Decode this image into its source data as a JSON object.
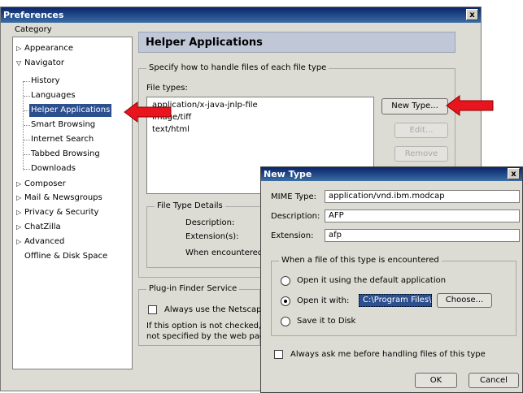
{
  "window": {
    "title": "Preferences",
    "close_label": "x"
  },
  "category": {
    "label": "Category",
    "items": [
      {
        "label": "Appearance"
      },
      {
        "label": "Navigator"
      },
      {
        "label": "History"
      },
      {
        "label": "Languages"
      },
      {
        "label": "Helper Applications"
      },
      {
        "label": "Smart Browsing"
      },
      {
        "label": "Internet Search"
      },
      {
        "label": "Tabbed Browsing"
      },
      {
        "label": "Downloads"
      },
      {
        "label": "Composer"
      },
      {
        "label": "Mail & Newsgroups"
      },
      {
        "label": "Privacy & Security"
      },
      {
        "label": "ChatZilla"
      },
      {
        "label": "Advanced"
      },
      {
        "label": "Offline & Disk Space"
      }
    ]
  },
  "panel": {
    "title": "Helper Applications",
    "group1_title": "Specify how to handle files of each file type",
    "file_types_label": "File types:",
    "file_types": [
      "application/x-java-jnlp-file",
      "image/tiff",
      "text/html"
    ],
    "new_type_button": "New Type...",
    "edit_button": "Edit...",
    "remove_button": "Remove",
    "details_title": "File Type Details",
    "description_label": "Description:",
    "extensions_label": "Extension(s):",
    "when_label": "When encountered",
    "plugin_title": "Plug-in Finder Service",
    "plugin_checkbox_label": "Always use the Netscape",
    "plugin_note_line1": "If this option is not checked, t",
    "plugin_note_line2": "not specified by the web pag"
  },
  "dialog": {
    "title": "New Type",
    "close_label": "x",
    "mime_label": "MIME Type:",
    "mime_value": "application/vnd.ibm.modcap",
    "description_label": "Description:",
    "description_value": "AFP",
    "extension_label": "Extension:",
    "extension_value": "afp",
    "group_title": "When a file of this type is encountered",
    "radio_default": "Open it using the default application",
    "radio_open_with": "Open it with:",
    "open_with_path": "C:\\Program Files\\IBM",
    "choose_button": "Choose...",
    "radio_save": "Save it to Disk",
    "ask_checkbox": "Always ask me before handling files of this type",
    "ok_button": "OK",
    "cancel_button": "Cancel"
  },
  "colors": {
    "arrow": "#e8141e",
    "selection": "#2b4f8f",
    "titlebar": "#0a246a"
  },
  "icons": {
    "collapsed": "triangle-right-icon",
    "expanded": "triangle-down-icon",
    "annotation": "red-arrow-icon"
  }
}
